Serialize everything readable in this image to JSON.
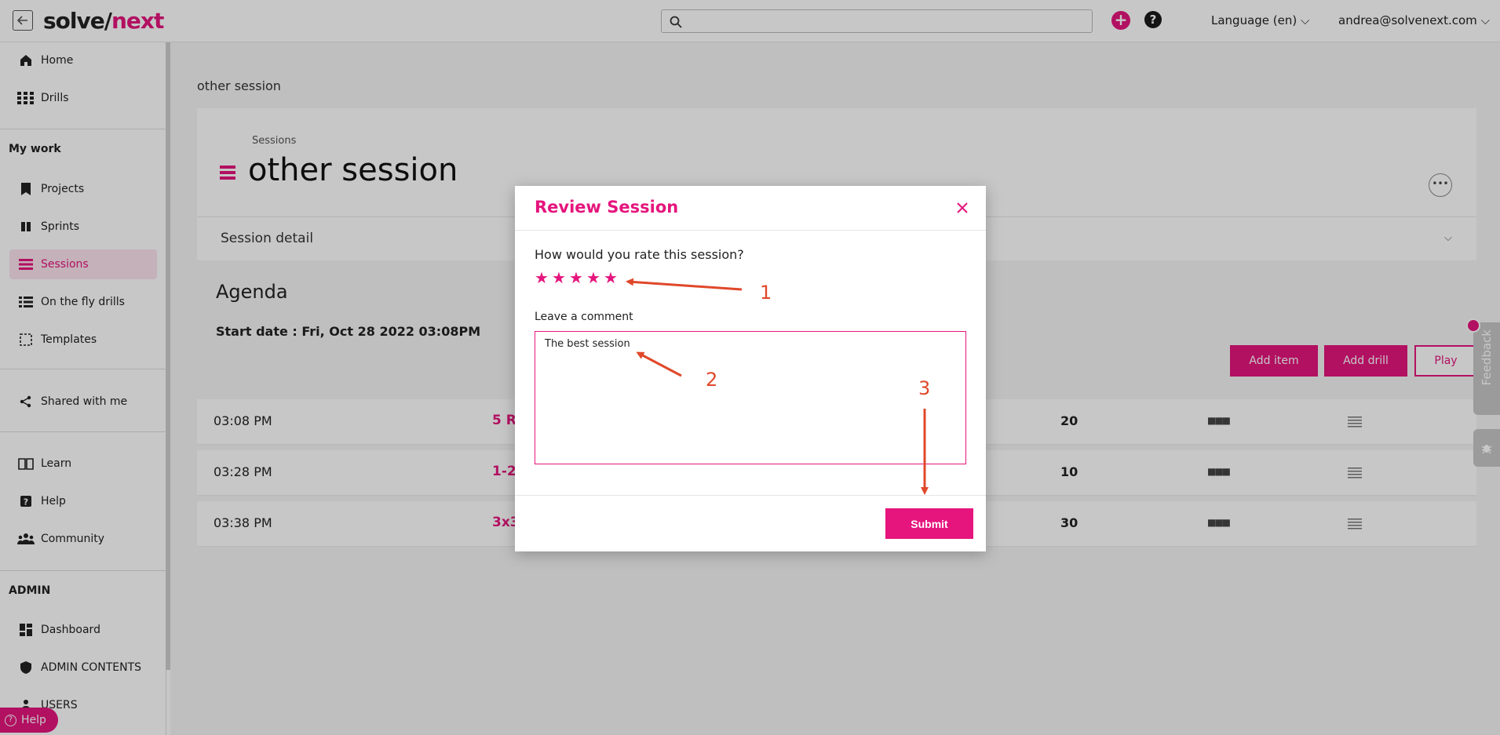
{
  "app": {
    "logo_part1": "solve/",
    "logo_part2": "next",
    "language": "Language (en)",
    "user_email": "andrea@solvenext.com"
  },
  "sidebar": {
    "items_top": [
      {
        "label": "Home",
        "icon": "home-icon"
      },
      {
        "label": "Drills",
        "icon": "grid-icon"
      }
    ],
    "my_work_heading": "My work",
    "my_work_items": [
      {
        "label": "Projects",
        "icon": "bookmark-icon"
      },
      {
        "label": "Sprints",
        "icon": "columns-icon"
      },
      {
        "label": "Sessions",
        "icon": "list-icon",
        "active": true
      },
      {
        "label": "On the fly drills",
        "icon": "list-icon"
      },
      {
        "label": "Templates",
        "icon": "template-icon"
      }
    ],
    "shared": {
      "label": "Shared with me",
      "icon": "share-icon"
    },
    "help_items": [
      {
        "label": "Learn",
        "icon": "book-icon"
      },
      {
        "label": "Help",
        "icon": "question-icon"
      },
      {
        "label": "Community",
        "icon": "people-icon"
      }
    ],
    "admin_heading": "ADMIN",
    "admin_items": [
      {
        "label": "Dashboard",
        "icon": "dashboard-icon"
      },
      {
        "label": "ADMIN CONTENTS",
        "icon": "shield-icon"
      },
      {
        "label": "USERS",
        "icon": "people-icon"
      }
    ],
    "help_pill": "Help"
  },
  "page": {
    "breadcrumb_top": "other session",
    "header_crumb": "Sessions",
    "title": "other session",
    "detail_label": "Session detail",
    "agenda_title": "Agenda",
    "start_date": "Start date : Fri, Oct 28 2022 03:08PM",
    "buttons": {
      "add_item": "Add item",
      "add_drill": "Add drill",
      "play": "Play"
    },
    "agenda_rows": [
      {
        "time": "03:08 PM",
        "name": "5 R",
        "duration": "20"
      },
      {
        "time": "03:28 PM",
        "name": "1-2",
        "duration": "10"
      },
      {
        "time": "03:38 PM",
        "name": "3x3",
        "duration": "30"
      }
    ],
    "feedback": "Feedback"
  },
  "modal": {
    "title": "Review Session",
    "question": "How would you rate this session?",
    "rating": 5,
    "rating_max": 5,
    "comment_label": "Leave a comment",
    "comment_value": "The best session",
    "submit": "Submit"
  },
  "annotations": {
    "n1": "1",
    "n2": "2",
    "n3": "3",
    "color": "#e0482a"
  },
  "colors": {
    "accent": "#e5157d"
  }
}
